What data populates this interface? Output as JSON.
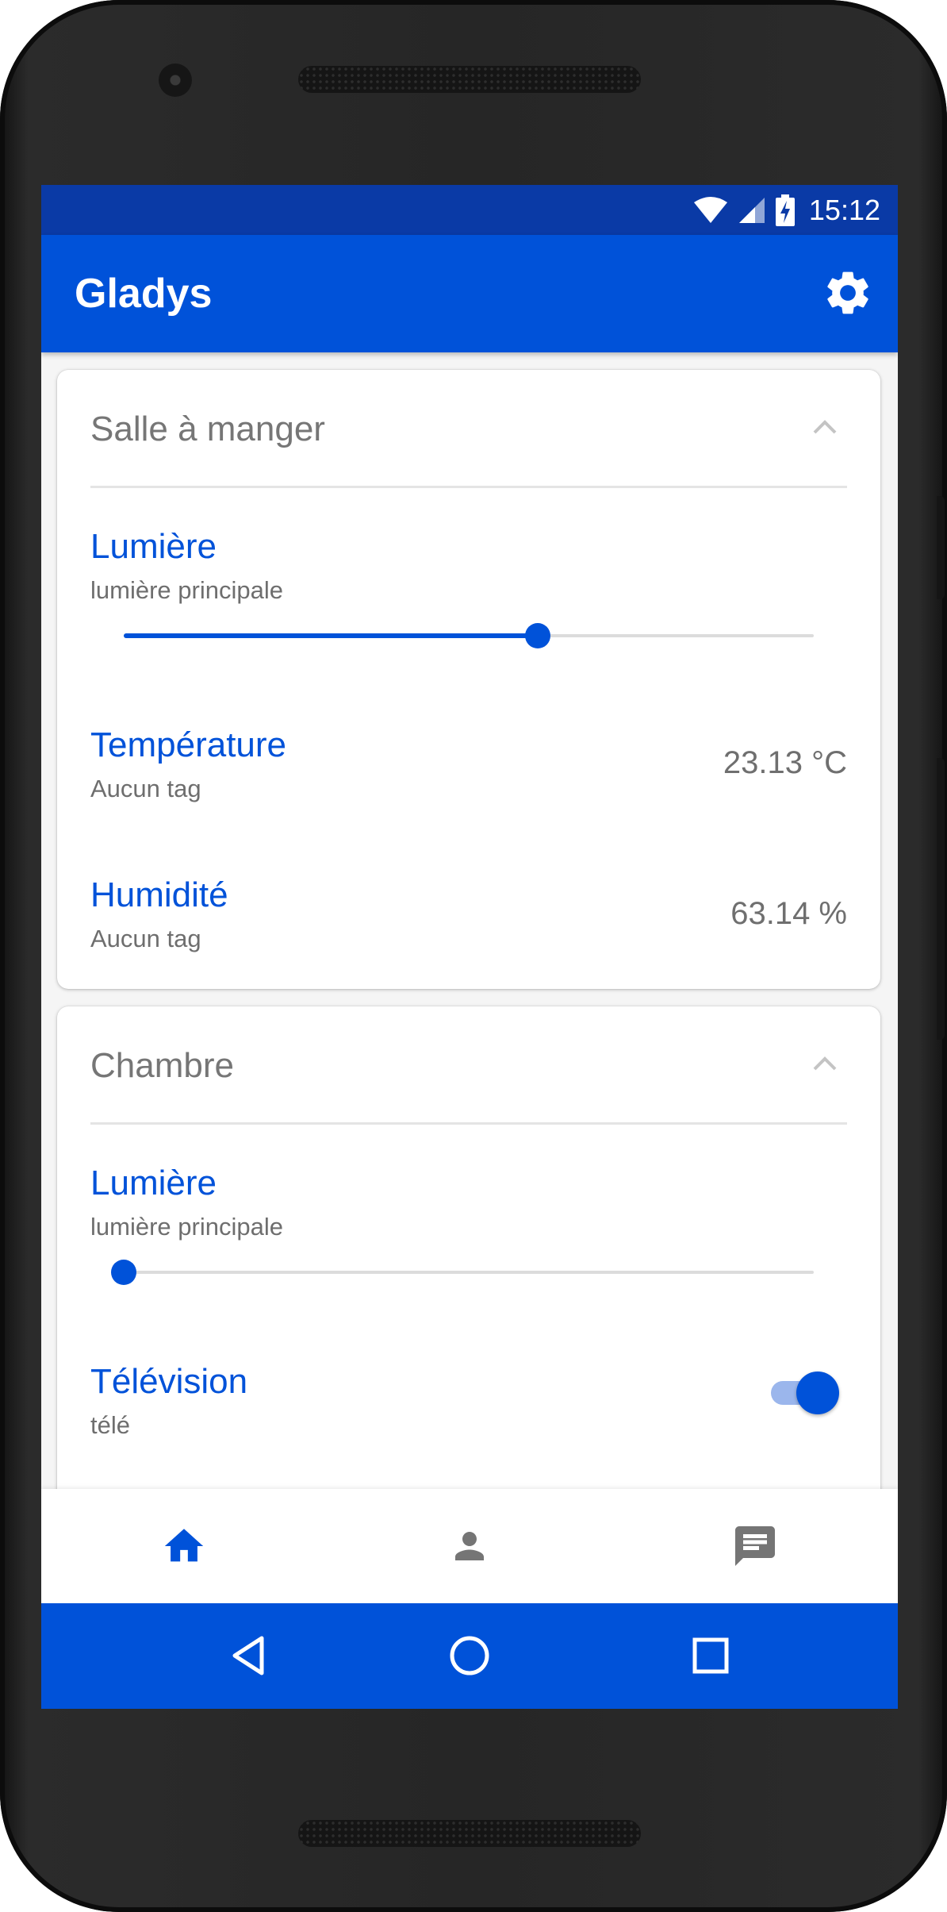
{
  "status_bar": {
    "time": "15:12",
    "icons": [
      "wifi-icon",
      "signal-icon",
      "battery-charging-icon"
    ]
  },
  "app_bar": {
    "title": "Gladys",
    "action_icon": "gear-icon"
  },
  "colors": {
    "primary": "#0052d9",
    "status_bar": "#0a3aa6",
    "title_grey": "#767676",
    "value_grey": "#6f6f6f"
  },
  "rooms": [
    {
      "name": "Salle à manger",
      "expanded": true,
      "devices": [
        {
          "title": "Lumière",
          "subtitle": "lumière principale",
          "type": "slider",
          "level": 0.6
        },
        {
          "title": "Température",
          "subtitle": "Aucun tag",
          "type": "value",
          "value": "23.13 °C"
        },
        {
          "title": "Humidité",
          "subtitle": "Aucun tag",
          "type": "value",
          "value": "63.14 %"
        }
      ]
    },
    {
      "name": "Chambre",
      "expanded": true,
      "devices": [
        {
          "title": "Lumière",
          "subtitle": "lumière principale",
          "type": "slider",
          "level": 0.0
        },
        {
          "title": "Télévision",
          "subtitle": "télé",
          "type": "toggle",
          "on": true
        }
      ]
    }
  ],
  "bottom_nav": [
    {
      "icon": "home-icon",
      "active": true
    },
    {
      "icon": "person-icon",
      "active": false
    },
    {
      "icon": "chat-icon",
      "active": false
    }
  ],
  "system_nav": [
    "back-icon",
    "home-circle-icon",
    "recents-icon"
  ]
}
